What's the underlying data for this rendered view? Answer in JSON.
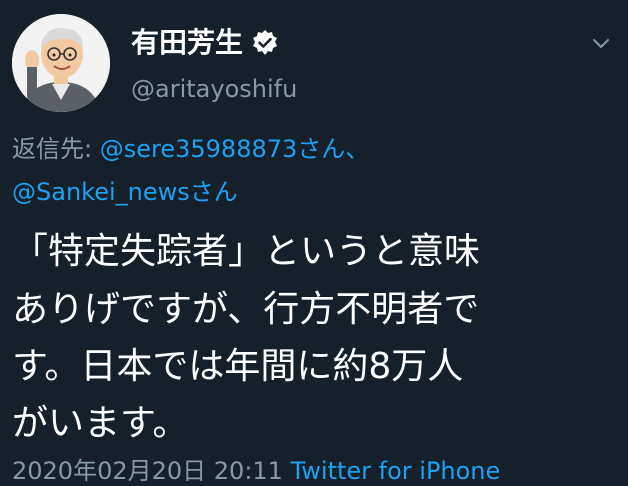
{
  "tweet": {
    "author": {
      "display_name": "有田芳生",
      "handle": "@aritayoshifu",
      "verified_icon": "verified-badge-icon",
      "avatar_icon": "cartoon-portrait-avatar"
    },
    "menu_icon": "chevron-down-icon",
    "reply_to": {
      "prefix": "返信先:",
      "mention_1": "@sere35988873さん、",
      "mention_2": "@Sankei_newsさん"
    },
    "body_lines": [
      "「特定失踪者」というと意味",
      "ありげですが、行方不明者で",
      "す。日本では年間に約8万人",
      "がいます。"
    ],
    "timestamp": {
      "time": "2020年02月20日 20:11 ",
      "via": "Twitter for iPhone"
    }
  },
  "colors": {
    "background": "#15202b",
    "text": "#ffffff",
    "secondary": "#8899a6",
    "link": "#1da1f2"
  }
}
